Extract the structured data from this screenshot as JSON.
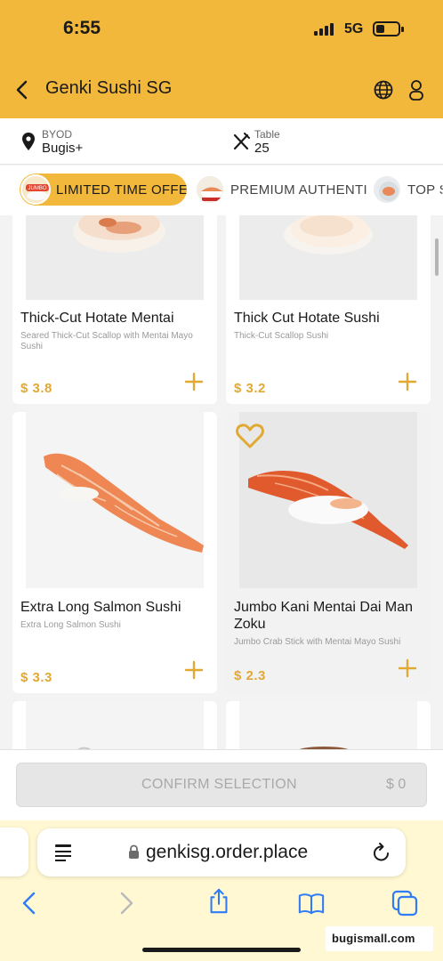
{
  "status_bar": {
    "time": "6:55",
    "network": "5G",
    "battery_level": 0.3
  },
  "header": {
    "title": "Genki Sushi SG",
    "background_color": "#f2b83c",
    "icons": [
      "back-arrow-icon",
      "globe-icon",
      "user-icon"
    ]
  },
  "info_bar": {
    "location_label": "BYOD",
    "location_value": "Bugis+",
    "table_label": "Table",
    "table_value": "25"
  },
  "category_tabs": [
    {
      "label": "LIMITED TIME OFFER",
      "active": true
    },
    {
      "label": "PREMIUM AUTHENTIC",
      "active": false
    },
    {
      "label": "TOP S",
      "active": false
    }
  ],
  "products": [
    {
      "name": "Thick-Cut Hotate Mentai",
      "description": "Seared Thick-Cut Scallop with Mentai Mayo Sushi",
      "price": "$ 3.8",
      "favorite": false
    },
    {
      "name": "Thick Cut Hotate Sushi",
      "description": "Thick-Cut Scallop Sushi",
      "price": "$ 3.2",
      "favorite": false
    },
    {
      "name": "Extra Long Salmon Sushi",
      "description": "Extra Long Salmon Sushi",
      "price": "$ 3.3",
      "favorite": false
    },
    {
      "name": "Jumbo Kani Mentai Dai Man Zoku",
      "description": "Jumbo Crab Stick with Mentai Mayo Sushi",
      "price": "$ 2.3",
      "favorite": true
    }
  ],
  "confirm": {
    "label": "CONFIRM SELECTION",
    "total": "$ 0"
  },
  "browser": {
    "url": "genkisg.order.place",
    "toolbar_icons": [
      "back-icon",
      "forward-icon",
      "share-icon",
      "bookmarks-icon",
      "tabs-icon"
    ]
  },
  "watermark": "bugismall.com",
  "accent_color": "#e2a834"
}
